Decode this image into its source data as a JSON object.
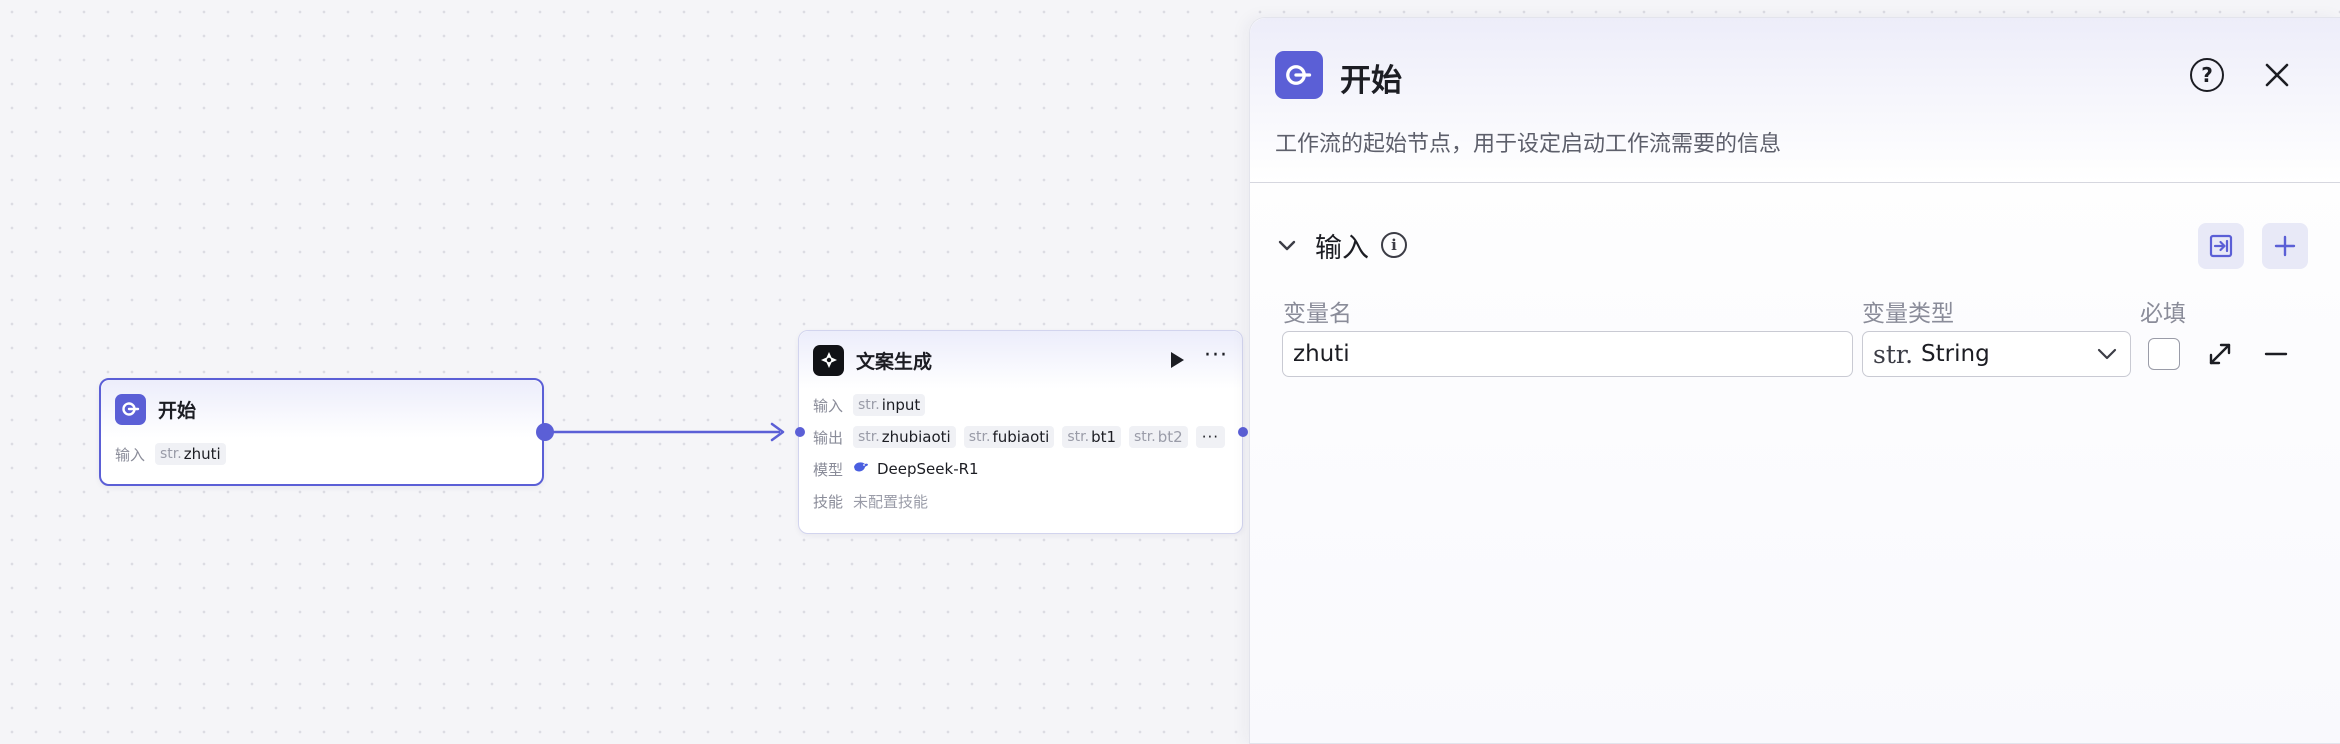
{
  "start_node": {
    "title": "开始",
    "input_label": "输入",
    "inputs": [
      {
        "type": "str.",
        "name": "zhuti"
      }
    ]
  },
  "gen_node": {
    "title": "文案生成",
    "input_label": "输入",
    "inputs": [
      {
        "type": "str.",
        "name": "input"
      }
    ],
    "output_label": "输出",
    "outputs": [
      {
        "type": "str.",
        "name": "zhubiaoti"
      },
      {
        "type": "str.",
        "name": "fubiaoti"
      },
      {
        "type": "str.",
        "name": "bt1"
      },
      {
        "type": "str.",
        "name": "bt2"
      }
    ],
    "more_outputs": "···",
    "model_label": "模型",
    "model_value": "DeepSeek-R1",
    "skill_label": "技能",
    "skill_value": "未配置技能"
  },
  "panel": {
    "title": "开始",
    "description": "工作流的起始节点，用于设定启动工作流需要的信息",
    "section_title": "输入",
    "columns": {
      "name": "变量名",
      "type": "变量类型",
      "required": "必填"
    },
    "variable": {
      "name": "zhuti",
      "type_prefix": "str.",
      "type": "String"
    },
    "help_glyph": "?",
    "info_glyph": "i"
  },
  "colors": {
    "accent": "#5b5fd6",
    "canvas_bg": "#f5f5f8",
    "node_border": "#d2d4ee",
    "muted_text": "#8a8c99"
  },
  "icons": {
    "start": "start-node-icon",
    "ai": "ai-robot-icon",
    "run": "play-icon",
    "more": "more-dots-icon",
    "help": "help-circle-icon",
    "close": "close-icon",
    "collapse": "chevron-down-icon",
    "info": "info-circle-icon",
    "import": "import-variable-icon",
    "add": "plus-icon",
    "expand": "expand-icon",
    "remove": "minus-icon"
  }
}
